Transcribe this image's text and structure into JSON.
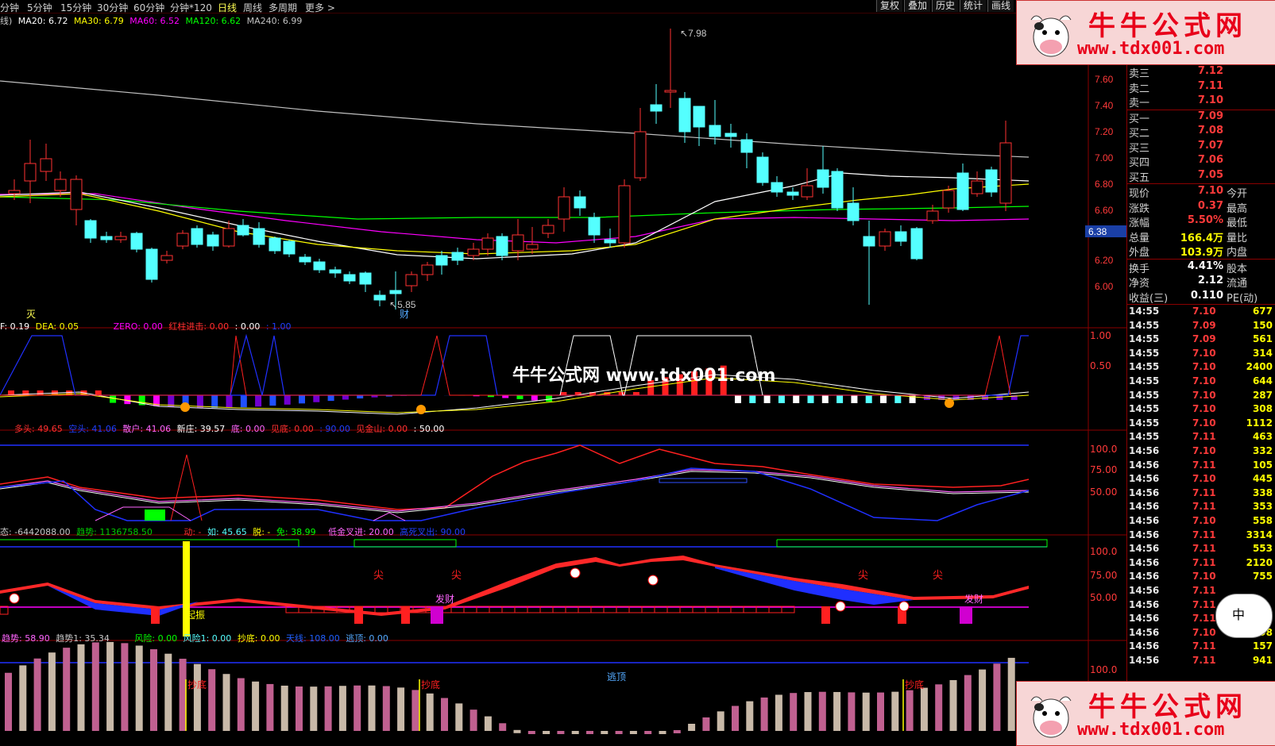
{
  "toolbar": {
    "periods": [
      "分钟",
      "5分钟",
      "15分钟",
      "30分钟",
      "60分钟",
      "分钟*120",
      "日线",
      "周线",
      "多周期",
      "更多"
    ],
    "active_period": "日线",
    "buttons": [
      "复权",
      "叠加",
      "历史",
      "统计",
      "画线"
    ]
  },
  "ma_legend": {
    "prefix": "线)",
    "ma20": "MA20: 6.72",
    "ma30": "MA30: 6.79",
    "ma60": "MA60: 6.52",
    "ma120": "MA120: 6.62",
    "ma240": "MA240: 6.99"
  },
  "price_axis": [
    "7.60",
    "7.40",
    "7.20",
    "7.00",
    "6.80",
    "6.60",
    "6.38",
    "6.20",
    "6.00"
  ],
  "price_annotations": {
    "high": "7.98",
    "low": "5.85",
    "cai": "财",
    "mie": "灭"
  },
  "macd_legend": {
    "dif": "F: 0.19",
    "dea": "DEA: 0.05",
    "zero": "ZERO: 0.00",
    "hong": "红柱进击: 0.00",
    "v1": ": 0.00",
    "v2": ": 1.00",
    "axis": [
      "1.00",
      "0.50"
    ]
  },
  "kd_legend": {
    "duotou": "多头: 49.65",
    "kongtou": "空头: 41.06",
    "sanhu": "散户: 41.06",
    "xinzhuang": "新庄: 39.57",
    "di": "底: 0.00",
    "jiandi": "见底: 0.00",
    "v90": ": 90.00",
    "jianjinshan": "见金山: 0.00",
    "v50": ": 50.00",
    "axis": [
      "100.0",
      "75.00",
      "50.00"
    ]
  },
  "trend_legend": {
    "a": "态: -6442088.00",
    "qushi": "趋势: 1136758.50",
    "dong": "动: -",
    "ru": "如: 45.65",
    "tuo": "脱: -",
    "mian": "免: 38.99",
    "dijin": "低金叉进: 20.00",
    "gaosi": "高死叉出: 90.00",
    "axis": [
      "100.0",
      "75.00",
      "50.00"
    ],
    "labels": {
      "jian1": "尖",
      "jian2": "尖",
      "jian3": "尖",
      "jian4": "尖",
      "facai1": "发财",
      "facai2": "发财",
      "qizhen": "起振"
    }
  },
  "bottom_legend": {
    "qushi": "趋势: 58.90",
    "qushi1": "趋势1: 35.34",
    "fengxian": "风险: 0.00",
    "fengxian1": "风险1: 0.00",
    "chaodi": "抄底: 0.00",
    "tianxian": "天线: 108.00",
    "taoding": "逃顶: 0.00",
    "axis": [
      "100.0"
    ],
    "labels": {
      "chaodi1": "抄底",
      "chaodi2": "抄底",
      "chaodi3": "抄底",
      "taoding": "逃顶"
    }
  },
  "order_book": [
    {
      "label": "卖三",
      "value": "7.12"
    },
    {
      "label": "卖二",
      "value": "7.11"
    },
    {
      "label": "卖一",
      "value": "7.10"
    },
    {
      "label": "买一",
      "value": "7.09"
    },
    {
      "label": "买二",
      "value": "7.08"
    },
    {
      "label": "买三",
      "value": "7.07"
    },
    {
      "label": "买四",
      "value": "7.06"
    },
    {
      "label": "买五",
      "value": "7.05"
    }
  ],
  "quote": [
    {
      "label": "现价",
      "value": "7.10",
      "label2": "今开"
    },
    {
      "label": "涨跌",
      "value": "0.37",
      "label2": "最高"
    },
    {
      "label": "涨幅",
      "value": "5.50%",
      "label2": "最低"
    },
    {
      "label": "总量",
      "value": "166.4万",
      "label2": "量比"
    },
    {
      "label": "外盘",
      "value": "103.9万",
      "label2": "内盘"
    }
  ],
  "fundamentals": [
    {
      "label": "换手",
      "value": "4.41%",
      "label2": "股本"
    },
    {
      "label": "净资",
      "value": "2.12",
      "label2": "流通"
    },
    {
      "label": "收益(三)",
      "value": "0.110",
      "label2": "PE(动)"
    }
  ],
  "ticks": [
    {
      "t": "14:55",
      "p": "7.10",
      "v": "677"
    },
    {
      "t": "14:55",
      "p": "7.09",
      "v": "150"
    },
    {
      "t": "14:55",
      "p": "7.09",
      "v": "561"
    },
    {
      "t": "14:55",
      "p": "7.10",
      "v": "314"
    },
    {
      "t": "14:55",
      "p": "7.10",
      "v": "2400"
    },
    {
      "t": "14:55",
      "p": "7.10",
      "v": "644"
    },
    {
      "t": "14:55",
      "p": "7.10",
      "v": "287"
    },
    {
      "t": "14:55",
      "p": "7.10",
      "v": "308"
    },
    {
      "t": "14:55",
      "p": "7.10",
      "v": "1112"
    },
    {
      "t": "14:55",
      "p": "7.11",
      "v": "463"
    },
    {
      "t": "14:56",
      "p": "7.10",
      "v": "332"
    },
    {
      "t": "14:56",
      "p": "7.11",
      "v": "105"
    },
    {
      "t": "14:56",
      "p": "7.10",
      "v": "445"
    },
    {
      "t": "14:56",
      "p": "7.11",
      "v": "338"
    },
    {
      "t": "14:56",
      "p": "7.11",
      "v": "353"
    },
    {
      "t": "14:56",
      "p": "7.10",
      "v": "558"
    },
    {
      "t": "14:56",
      "p": "7.11",
      "v": "3314"
    },
    {
      "t": "14:56",
      "p": "7.11",
      "v": "553"
    },
    {
      "t": "14:56",
      "p": "7.11",
      "v": "2120"
    },
    {
      "t": "14:56",
      "p": "7.10",
      "v": "755"
    },
    {
      "t": "14:56",
      "p": "7.11",
      "v": ""
    },
    {
      "t": "14:56",
      "p": "7.11",
      "v": ""
    },
    {
      "t": "14:56",
      "p": "7.11",
      "v": ""
    },
    {
      "t": "14:56",
      "p": "7.10",
      "v": "198"
    },
    {
      "t": "14:56",
      "p": "7.11",
      "v": "157"
    },
    {
      "t": "14:56",
      "p": "7.11",
      "v": "941"
    }
  ],
  "watermark": {
    "title": "牛牛公式网",
    "url": "www.tdx001.com",
    "center": "牛牛公式网 www.tdx001.com",
    "cow_text": "中"
  },
  "colors": {
    "up": "#ff3232",
    "down": "#54ffff",
    "ma20": "#ffffff",
    "ma30": "#ffff00",
    "ma60": "#ff00ff",
    "ma120": "#00ff00",
    "ma240": "#c0c0c0"
  }
}
